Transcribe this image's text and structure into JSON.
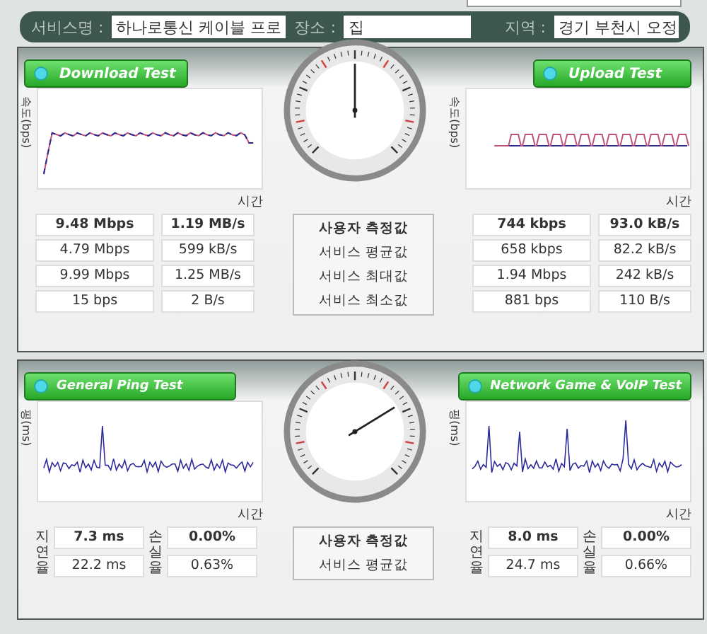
{
  "header": {
    "fields": [
      {
        "label": "서비스명 :",
        "value": "하나로통신 케이블 프로"
      },
      {
        "label": "장소 :",
        "value": "집"
      },
      {
        "label": "지역 :",
        "value": "경기 부천시 오정"
      }
    ]
  },
  "speed": {
    "left": {
      "title": "Download Test",
      "y_label": "속도(bps)",
      "x_label": "시간",
      "rows": [
        [
          "9.48 Mbps",
          "1.19 MB/s"
        ],
        [
          "4.79 Mbps",
          "599 kB/s"
        ],
        [
          "9.99 Mbps",
          "1.25 MB/s"
        ],
        [
          "15 bps",
          "2 B/s"
        ]
      ]
    },
    "right": {
      "title": "Upload Test",
      "y_label": "속도(bps)",
      "x_label": "시간",
      "rows": [
        [
          "744 kbps",
          "93.0 kB/s"
        ],
        [
          "658 kbps",
          "82.2 kB/s"
        ],
        [
          "1.94 Mbps",
          "242 kB/s"
        ],
        [
          "881 bps",
          "110 B/s"
        ]
      ]
    },
    "legend": [
      "사용자 측정값",
      "서비스 평균값",
      "서비스 최대값",
      "서비스 최소값"
    ]
  },
  "ping": {
    "left": {
      "title": "General Ping Test",
      "y_label": "핑(ms)",
      "x_label": "시간",
      "col_labels": [
        "지연율",
        "손실율"
      ],
      "rows": [
        [
          "7.3 ms",
          "0.00%"
        ],
        [
          "22.2 ms",
          "0.63%"
        ]
      ]
    },
    "right": {
      "title": "Network Game & VoIP Test",
      "y_label": "핑(ms)",
      "x_label": "시간",
      "col_labels": [
        "지연율",
        "손실율"
      ],
      "rows": [
        [
          "8.0 ms",
          "0.00%"
        ],
        [
          "24.7 ms",
          "0.66%"
        ]
      ]
    },
    "legend": [
      "사용자 측정값",
      "서비스 평균값"
    ]
  }
}
